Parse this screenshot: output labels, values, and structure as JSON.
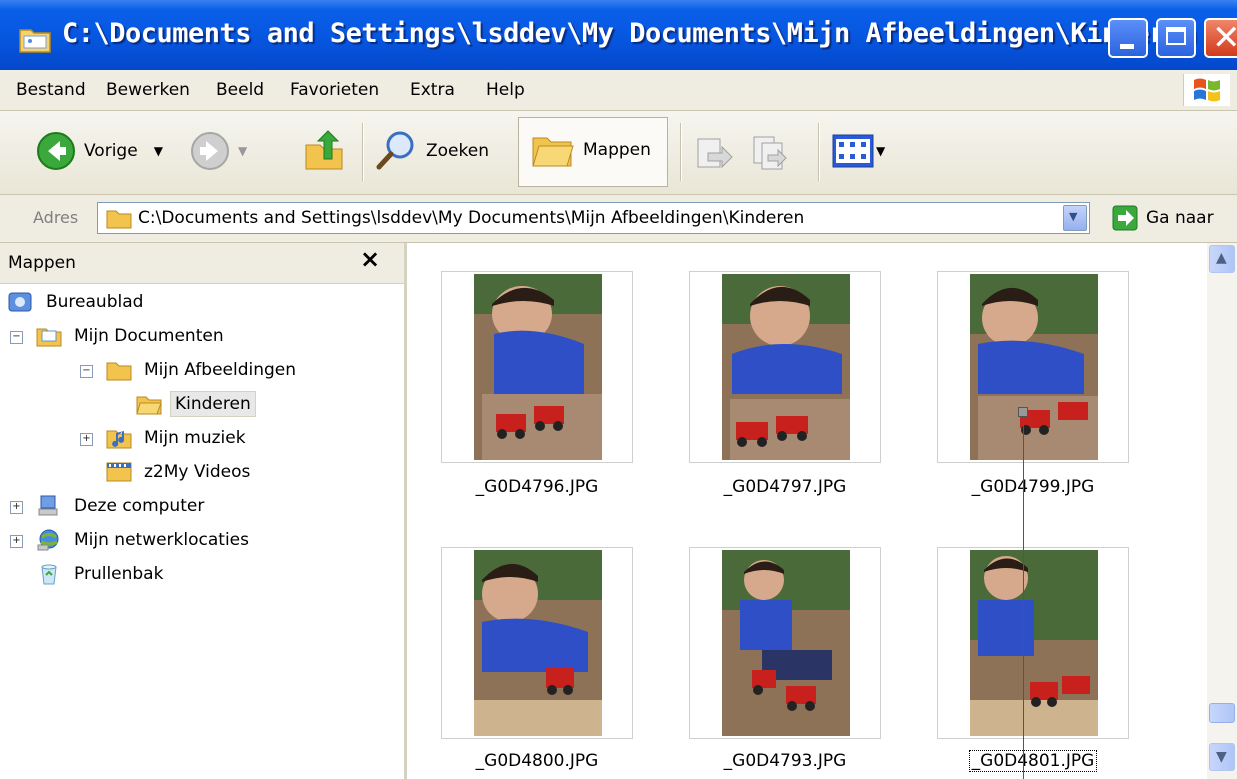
{
  "window": {
    "title": "C:\\Documents and Settings\\lsddev\\My Documents\\Mijn Afbeeldingen\\Kinderen",
    "title_color": "#0655df"
  },
  "menu": {
    "items": [
      {
        "label": "Bestand"
      },
      {
        "label": "Bewerken"
      },
      {
        "label": "Beeld"
      },
      {
        "label": "Favorieten"
      },
      {
        "label": "Extra"
      },
      {
        "label": "Help"
      }
    ]
  },
  "toolbar": {
    "back_label": "Vorige",
    "search_label": "Zoeken",
    "folders_label": "Mappen"
  },
  "address": {
    "label": "Adres",
    "path": "C:\\Documents and Settings\\lsddev\\My Documents\\Mijn Afbeeldingen\\Kinderen",
    "go_label": "Ga naar"
  },
  "folder_pane": {
    "title": "Mappen",
    "close_glyph": "×",
    "tree": [
      {
        "label": "Bureaublad",
        "icon": "desktop-icon"
      },
      {
        "label": "Mijn Documenten",
        "icon": "my-documents-icon",
        "expander": "−"
      },
      {
        "label": "Mijn Afbeeldingen",
        "icon": "folder-icon",
        "expander": "−"
      },
      {
        "label": "Kinderen",
        "icon": "folder-open-icon",
        "selected": true
      },
      {
        "label": "Mijn muziek",
        "icon": "music-folder-icon",
        "expander": "+"
      },
      {
        "label": "z2My Videos",
        "icon": "video-folder-icon"
      },
      {
        "label": "Deze computer",
        "icon": "computer-icon",
        "expander": "+"
      },
      {
        "label": "Mijn netwerklocaties",
        "icon": "network-icon",
        "expander": "+"
      },
      {
        "label": "Prullenbak",
        "icon": "recycle-bin-icon"
      }
    ]
  },
  "files": [
    {
      "name": "_G0D4796.JPG"
    },
    {
      "name": "_G0D4797.JPG"
    },
    {
      "name": "_G0D4799.JPG"
    },
    {
      "name": "_G0D4800.JPG"
    },
    {
      "name": "_G0D4793.JPG"
    },
    {
      "name": "_G0D4801.JPG",
      "focused": true
    }
  ]
}
